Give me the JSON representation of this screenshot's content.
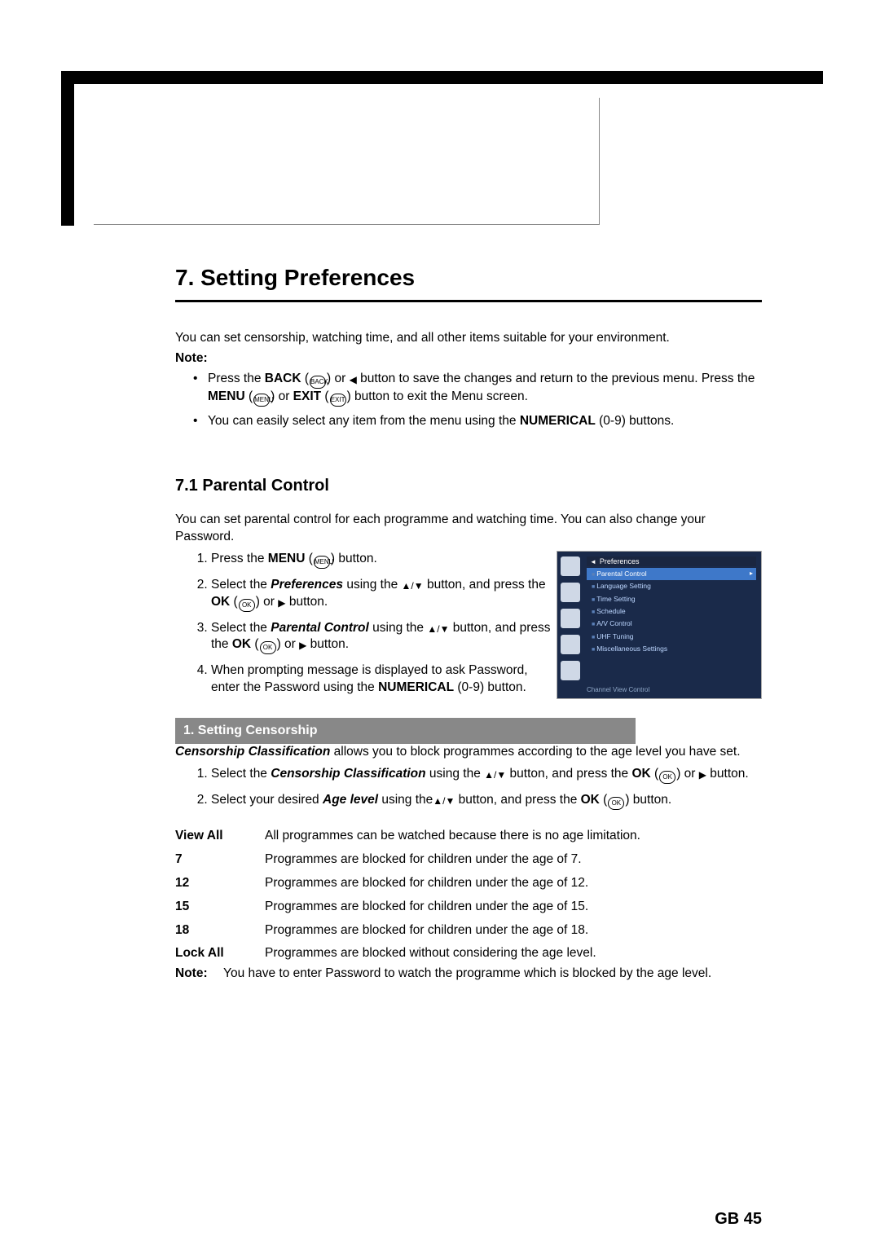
{
  "chapter_title": "7. Setting Preferences",
  "intro": "You can set censorship, watching time, and all other items suitable for your environment.",
  "note_label": "Note:",
  "notes": [
    {
      "pre": "Press the ",
      "b1": "BACK",
      "mid1": " (",
      "mid2": ") or ",
      "mid3": " button to save the changes and return to the previous menu. Press the ",
      "b2": "MENU",
      "mid4": " (",
      "mid5": ") or ",
      "b3": "EXIT",
      "mid6": " (",
      "mid7": ") button to exit the Menu screen."
    },
    {
      "pre": "You can easily select any item from the menu using the ",
      "b1": "NUMERICAL",
      "post": " (0-9) buttons."
    }
  ],
  "section_title": "7.1 Parental Control",
  "section_intro": "You can set parental control for each programme and watching time. You can also change your Password.",
  "steps1": [
    {
      "pre": "Press the ",
      "b1": "MENU",
      "mid": " (",
      "post": ") button."
    },
    {
      "pre": "Select the ",
      "i1": "Preferences",
      "mid1": " using the ",
      "mid2": " button, and press the ",
      "b1": "OK",
      "mid3": " (",
      "mid4": ") or ",
      "post": " button."
    },
    {
      "pre": "Select the ",
      "i1": "Parental Control",
      "mid1": " using the ",
      "mid2": " button, and press the ",
      "b1": "OK",
      "mid3": " (",
      "mid4": ") or ",
      "post": " button."
    },
    {
      "pre": "When prompting message is displayed to ask Password, enter the Password using the ",
      "b1": "NUMERICAL",
      "post": " (0-9) button."
    }
  ],
  "subhead": "1. Setting Censorship",
  "censor_intro_i": "Censorship Classification",
  "censor_intro_rest": " allows you to block programmes according to the age level you have set.",
  "steps2": [
    {
      "pre": "Select the ",
      "i1": "Censorship Classification",
      "mid1": " using the ",
      "mid2": " button, and press the ",
      "b1": "OK",
      "mid3": " (",
      "mid4": ") or ",
      "post": " button."
    },
    {
      "pre": "Select your desired ",
      "i1": "Age level",
      "mid1": " using the",
      "mid2": " button, and press the ",
      "b1": "OK",
      "mid3": " (",
      "post": ") button."
    }
  ],
  "age_rows": [
    {
      "k": "View All",
      "v": "All programmes can be watched because there is no age limitation."
    },
    {
      "k": "7",
      "v": "Programmes are blocked for children under the age of 7."
    },
    {
      "k": "12",
      "v": "Programmes are blocked for children under the age of 12."
    },
    {
      "k": "15",
      "v": "Programmes are blocked for children under the age of 15."
    },
    {
      "k": "18",
      "v": "Programmes are blocked for children under the age of 18."
    },
    {
      "k": "Lock All",
      "v": "Programmes are blocked without considering the age level."
    }
  ],
  "final_note_label": "Note:",
  "final_note_text": "You have to enter Password to watch the programme which is blocked by the age level.",
  "thumb": {
    "title": "Preferences",
    "items": [
      "Parental Control",
      "Language Setting",
      "Time Setting",
      "Schedule",
      "A/V Control",
      "UHF Tuning",
      "Miscellaneous Settings"
    ],
    "footer": "Channel  View  Control"
  },
  "page_num": "GB 45",
  "icon_labels": {
    "menu": "MENU",
    "ok": "OK",
    "exit": "EXIT",
    "back": "BACK"
  }
}
